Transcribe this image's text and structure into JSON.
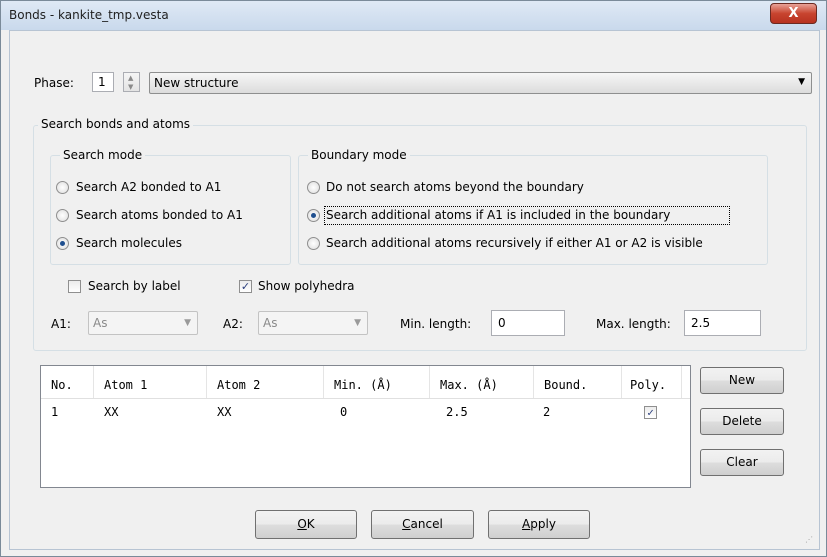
{
  "window": {
    "title": "Bonds - kankite_tmp.vesta",
    "close_glyph": "X"
  },
  "phase": {
    "label": "Phase:",
    "value": "1",
    "structure": "New structure"
  },
  "search_group": {
    "title": "Search bonds and atoms",
    "search_mode": {
      "title": "Search mode",
      "options": [
        {
          "label": "Search A2 bonded to A1",
          "selected": false
        },
        {
          "label": "Search atoms bonded to A1",
          "selected": false
        },
        {
          "label": "Search molecules",
          "selected": true
        }
      ]
    },
    "boundary_mode": {
      "title": "Boundary mode",
      "options": [
        {
          "label": "Do not search atoms beyond the boundary",
          "selected": false
        },
        {
          "label": "Search additional atoms if A1 is included in the boundary",
          "selected": true
        },
        {
          "label": "Search additional atoms recursively if either A1 or A2 is visible",
          "selected": false
        }
      ]
    },
    "search_by_label": {
      "label": "Search by label",
      "checked": false
    },
    "show_polyhedra": {
      "label": "Show polyhedra",
      "checked": true
    },
    "a1": {
      "label": "A1:",
      "value": "As"
    },
    "a2": {
      "label": "A2:",
      "value": "As"
    },
    "min_length": {
      "label": "Min. length:",
      "value": "0"
    },
    "max_length": {
      "label": "Max. length:",
      "value": "2.5"
    }
  },
  "table": {
    "headers": [
      "No.",
      "Atom 1",
      "Atom 2",
      "Min. (Å)",
      "Max. (Å)",
      "Bound.",
      "Poly."
    ],
    "rows": [
      {
        "no": "1",
        "atom1": "XX",
        "atom2": "XX",
        "min": "0",
        "max": "2.5",
        "bound": "2",
        "poly": true
      }
    ]
  },
  "side_buttons": {
    "new": "New",
    "delete": "Delete",
    "clear": "Clear"
  },
  "footer_buttons": {
    "ok": {
      "mnemonic": "O",
      "rest": "K"
    },
    "cancel": {
      "mnemonic": "C",
      "rest": "ancel"
    },
    "apply": {
      "mnemonic": "A",
      "rest": "pply"
    }
  },
  "icons": {
    "spin_up": "▲",
    "spin_down": "▼",
    "dropdown": "▼",
    "check": "✓",
    "grip": "⋰"
  },
  "colors": {
    "titlebar": "#c9d9ec",
    "close_button": "#c8442f",
    "radio_dot": "#1f4f8f",
    "window_bg": "#f0f0f0"
  }
}
